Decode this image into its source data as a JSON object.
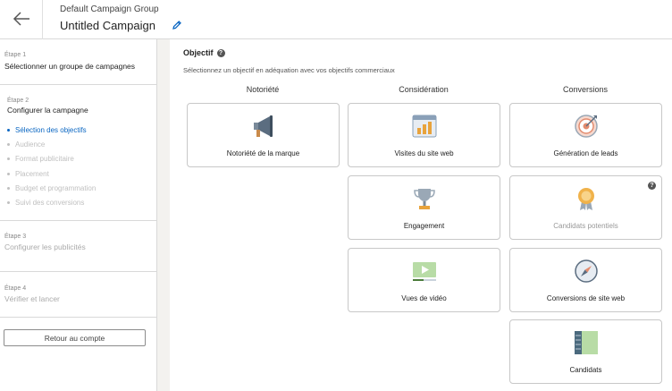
{
  "header": {
    "group_name": "Default Campaign Group",
    "campaign_name": "Untitled Campaign"
  },
  "sidebar": {
    "step1": {
      "label": "Étape 1",
      "title": "Sélectionner un groupe de campagnes"
    },
    "step2": {
      "label": "Étape 2",
      "title": "Configurer la campagne",
      "substeps": [
        "Sélection des objectifs",
        "Audience",
        "Format publicitaire",
        "Placement",
        "Budget et programmation",
        "Suivi des conversions"
      ]
    },
    "step3": {
      "label": "Étape 3",
      "title": "Configurer les publicités"
    },
    "step4": {
      "label": "Étape 4",
      "title": "Vérifier et lancer"
    },
    "return_label": "Retour au compte"
  },
  "main": {
    "title": "Objectif",
    "help_icon": "?",
    "description": "Sélectionnez un objectif en adéquation avec vos objectifs commerciaux",
    "columns": [
      "Notoriété",
      "Considération",
      "Conversions"
    ],
    "cards": {
      "brand_awareness": "Notoriété de la marque",
      "website_visits": "Visites du site web",
      "engagement": "Engagement",
      "video_views": "Vues de vidéo",
      "lead_generation": "Génération de leads",
      "talent_leads": "Candidats potentiels",
      "website_conversions": "Conversions de site web",
      "job_applicants": "Candidats"
    }
  },
  "colors": {
    "accent": "#0a66c2",
    "disabled_text": "#999999"
  }
}
